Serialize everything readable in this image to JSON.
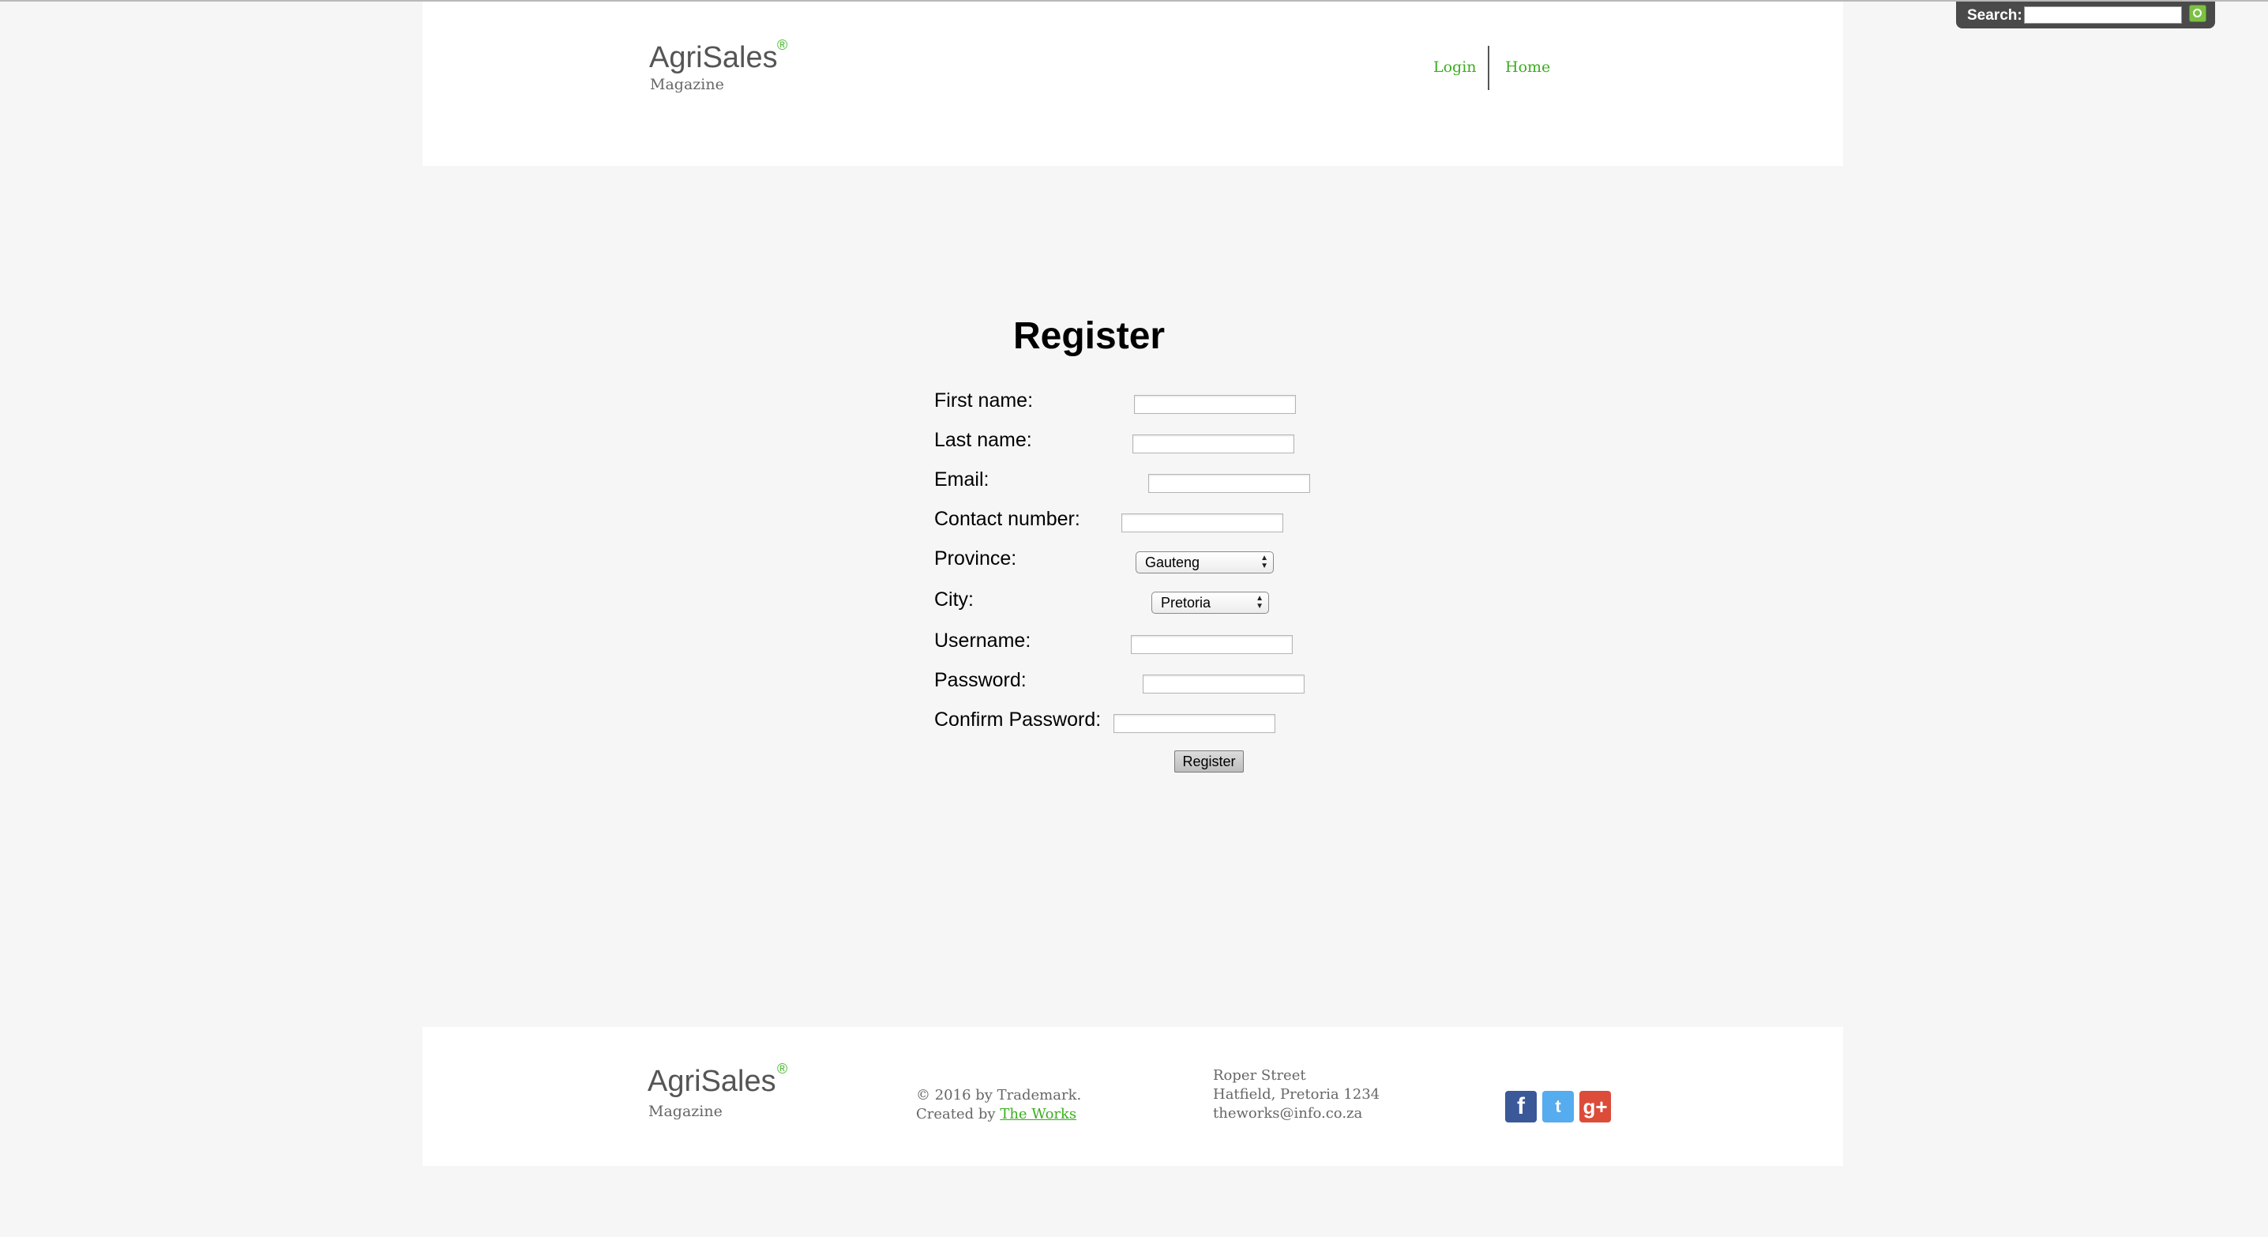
{
  "search": {
    "label": "Search:",
    "value": "",
    "placeholder": ""
  },
  "header": {
    "logo_name": "AgriSales",
    "logo_reg": "®",
    "logo_sub": "Magazine",
    "nav": [
      {
        "label": "Login"
      },
      {
        "label": "Home"
      }
    ]
  },
  "register": {
    "title": "Register",
    "fields": {
      "first_name": {
        "label": "First name:",
        "value": ""
      },
      "last_name": {
        "label": "Last name:",
        "value": ""
      },
      "email": {
        "label": "Email:",
        "value": ""
      },
      "contact_number": {
        "label": "Contact number:",
        "value": ""
      },
      "province": {
        "label": "Province:",
        "selected": "Gauteng"
      },
      "city": {
        "label": "City:",
        "selected": "Pretoria"
      },
      "username": {
        "label": "Username:",
        "value": ""
      },
      "password": {
        "label": "Password:",
        "value": ""
      },
      "confirm_password": {
        "label": "Confirm Password:",
        "value": ""
      }
    },
    "submit_label": "Register"
  },
  "footer": {
    "logo_name": "AgriSales",
    "logo_reg": "®",
    "logo_sub": "Magazine",
    "copyright": "© 2016 by Trademark.",
    "created_by_prefix": "Created by",
    "created_by_link": "The Works",
    "address_line1": "Roper Street",
    "address_line2": "Hatfield, Pretoria 1234",
    "address_email": "theworks@info.co.za",
    "social": [
      {
        "name": "facebook-icon",
        "glyph": "f"
      },
      {
        "name": "twitter-icon",
        "glyph": "t"
      },
      {
        "name": "google-plus-icon",
        "glyph": "g+"
      }
    ]
  },
  "colors": {
    "accent_green": "#3aae1f",
    "page_bg": "#f6f6f6",
    "search_bar_bg": "#4a4a4a"
  }
}
